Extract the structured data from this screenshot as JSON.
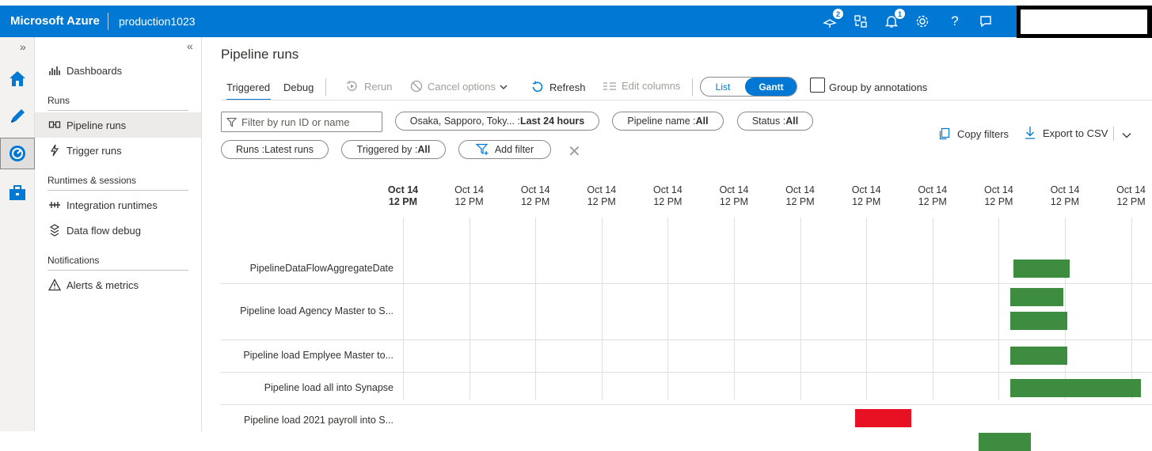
{
  "topbar": {
    "brand": "Microsoft Azure",
    "workspace": "production1023",
    "badges": {
      "updates": "2",
      "notifications": "1"
    },
    "icons": [
      "publish-icon",
      "switch-directory-icon",
      "notifications-icon",
      "gear-icon",
      "help-icon",
      "feedback-icon"
    ],
    "color": "#0078d4"
  },
  "leftrail": {
    "expand_label": "»",
    "items": [
      "home-icon",
      "author-pencil-icon",
      "monitor-icon",
      "manage-toolbox-icon"
    ],
    "selected": "monitor-icon"
  },
  "nav": {
    "collapse_label": "«",
    "dashboards": "Dashboards",
    "runs_header": "Runs",
    "pipeline_runs": "Pipeline runs",
    "trigger_runs": "Trigger runs",
    "runtimes_header": "Runtimes & sessions",
    "integration_runtimes": "Integration runtimes",
    "data_flow_debug": "Data flow debug",
    "notifications_header": "Notifications",
    "alerts_metrics": "Alerts & metrics"
  },
  "page": {
    "title": "Pipeline runs",
    "tabs": {
      "triggered": "Triggered",
      "debug": "Debug",
      "active": "triggered"
    },
    "toolbar": {
      "rerun": "Rerun",
      "cancel_options": "Cancel options",
      "refresh": "Refresh",
      "edit_columns": "Edit columns",
      "view_list": "List",
      "view_gantt": "Gantt",
      "active_view": "Gantt",
      "group_by_annotations": "Group by annotations",
      "group_by_checked": false
    },
    "filters": {
      "search_placeholder": "Filter by run ID or name",
      "timezone_prefix": "Osaka, Sapporo, Toky... : ",
      "timezone_value": "Last 24 hours",
      "pipeline_name_prefix": "Pipeline name : ",
      "pipeline_name_value": "All",
      "status_prefix": "Status : ",
      "status_value": "All",
      "runs_prefix": "Runs : ",
      "runs_value": "Latest runs",
      "triggered_by_prefix": "Triggered by : ",
      "triggered_by_value": "All",
      "add_filter": "Add filter",
      "copy_filters": "Copy filters",
      "export_csv": "Export to CSV"
    }
  },
  "gantt": {
    "columns": [
      {
        "day": "Oct 14",
        "time": "12 PM",
        "bold": true
      },
      {
        "day": "Oct 14",
        "time": "12 PM"
      },
      {
        "day": "Oct 14",
        "time": "12 PM"
      },
      {
        "day": "Oct 14",
        "time": "12 PM"
      },
      {
        "day": "Oct 14",
        "time": "12 PM"
      },
      {
        "day": "Oct 14",
        "time": "12 PM"
      },
      {
        "day": "Oct 14",
        "time": "12 PM"
      },
      {
        "day": "Oct 14",
        "time": "12 PM"
      },
      {
        "day": "Oct 14",
        "time": "12 PM"
      },
      {
        "day": "Oct 14",
        "time": "12 PM"
      },
      {
        "day": "Oct 14",
        "time": "12 PM"
      },
      {
        "day": "Oct 14",
        "time": "12 PM"
      }
    ],
    "rows": [
      {
        "name": "PipelineDataFlowAggregateDate",
        "runs": [
          {
            "status": "Succeeded",
            "start": 9.22,
            "end": 10.07
          }
        ]
      },
      {
        "name": "Pipeline load Agency Master to S...",
        "runs": [
          {
            "status": "Succeeded",
            "start": 9.18,
            "end": 9.98
          },
          {
            "status": "Succeeded",
            "start": 9.18,
            "end": 10.04
          }
        ]
      },
      {
        "name": "Pipeline load Emplyee Master to...",
        "runs": [
          {
            "status": "Succeeded",
            "start": 9.18,
            "end": 10.04
          }
        ]
      },
      {
        "name": "Pipeline load all into Synapse",
        "runs": [
          {
            "status": "Succeeded",
            "start": 9.18,
            "end": 11.15
          }
        ]
      },
      {
        "name": "Pipeline load 2021 payroll into S...",
        "runs": [
          {
            "status": "Failed",
            "start": 6.83,
            "end": 7.68
          },
          {
            "status": "Succeeded",
            "start": 8.7,
            "end": 9.48
          }
        ]
      }
    ],
    "status_colors": {
      "Succeeded": "#3d8c40",
      "Failed": "#e81123"
    }
  }
}
